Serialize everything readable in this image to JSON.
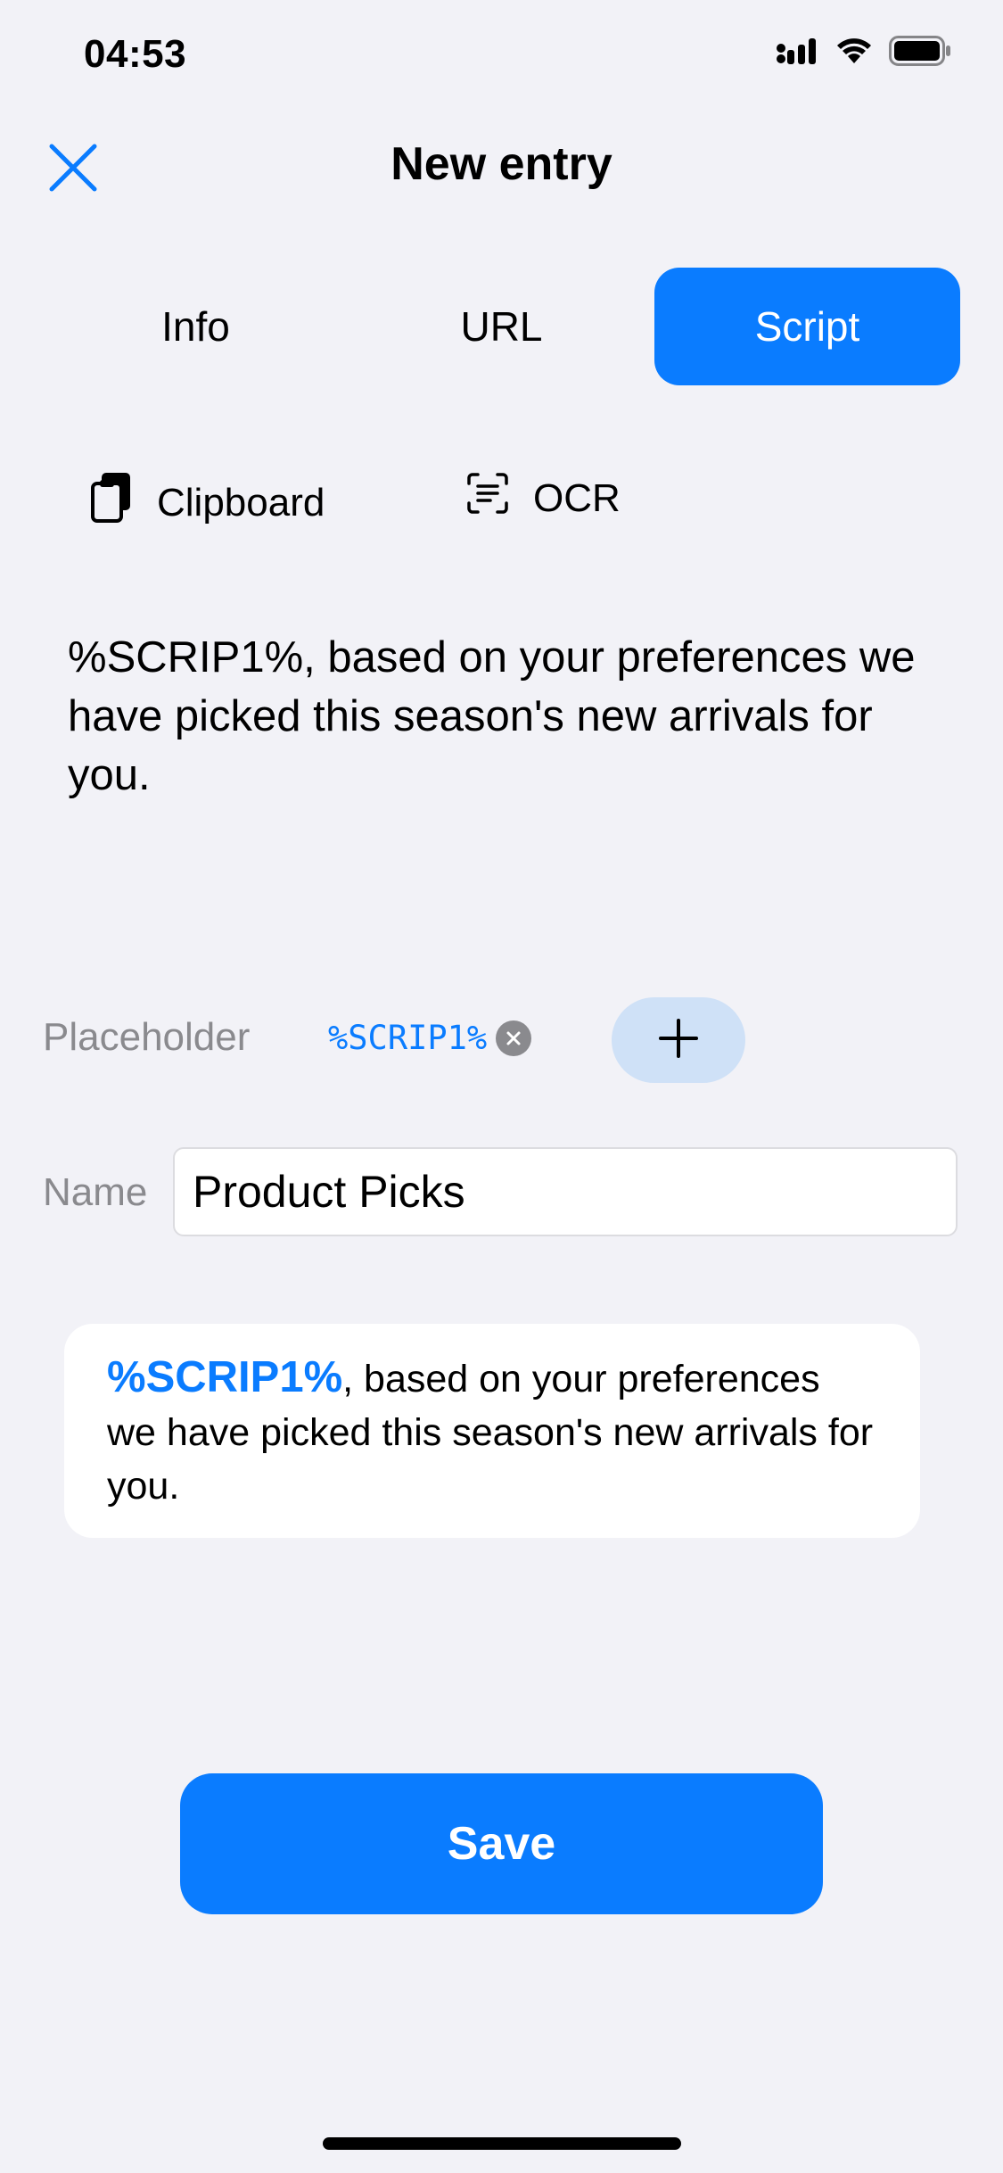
{
  "status_bar": {
    "time": "04:53",
    "icons": [
      "signal-icon",
      "wifi-icon",
      "battery-icon"
    ]
  },
  "nav": {
    "title": "New entry",
    "close_icon": "close-icon"
  },
  "segments": [
    {
      "label": "Info",
      "active": false
    },
    {
      "label": "URL",
      "active": false
    },
    {
      "label": "Script",
      "active": true
    }
  ],
  "tools": {
    "clipboard_label": "Clipboard",
    "ocr_label": "OCR"
  },
  "script": {
    "text": "%SCRIP1%, based on your preferences we have picked this season's new arrivals for you."
  },
  "placeholder": {
    "label": "Placeholder",
    "chip": "%SCRIP1%"
  },
  "name": {
    "label": "Name",
    "value": "Product Picks"
  },
  "preview": {
    "placeholder": "%SCRIP1%",
    "rest": ", based on your preferences we have picked this season's new arrivals for you."
  },
  "save_label": "Save",
  "colors": {
    "accent": "#0a7cff",
    "background": "#f2f2f7",
    "add_button": "#cfe1f7",
    "secondary_text": "#8a8a8e"
  }
}
